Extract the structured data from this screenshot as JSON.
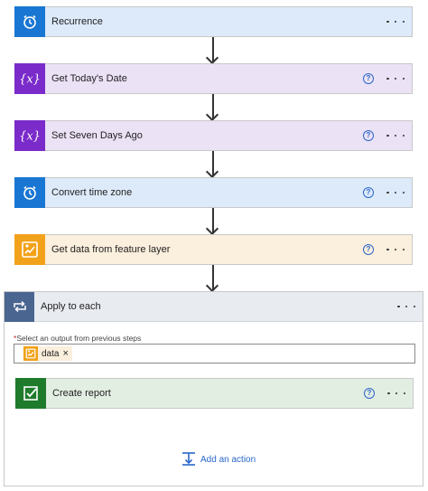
{
  "steps": [
    {
      "title": "Recurrence",
      "icon": "alarm-clock-icon",
      "has_help": false
    },
    {
      "title": "Get Today's Date",
      "icon": "variable-icon",
      "has_help": true
    },
    {
      "title": "Set Seven Days Ago",
      "icon": "variable-icon",
      "has_help": true
    },
    {
      "title": "Convert time zone",
      "icon": "alarm-clock-icon",
      "has_help": true
    },
    {
      "title": "Get data from feature layer",
      "icon": "map-layer-icon",
      "has_help": true
    }
  ],
  "apply_to_each": {
    "title": "Apply to each",
    "icon": "loop-icon",
    "select_label": "Select an output from previous steps",
    "required_mark": "*",
    "token_label": "data",
    "token_remove": "×",
    "inner_step": {
      "title": "Create report",
      "icon": "report-check-icon"
    },
    "add_action_label": "Add an action"
  },
  "help_glyph": "?",
  "colors": {
    "blue_accent": "#1976d2",
    "purple_accent": "#7a2bc9",
    "orange_accent": "#f2a21a",
    "green_accent": "#1e7b2c",
    "loop_accent": "#4a6590",
    "link": "#2a66c9"
  }
}
